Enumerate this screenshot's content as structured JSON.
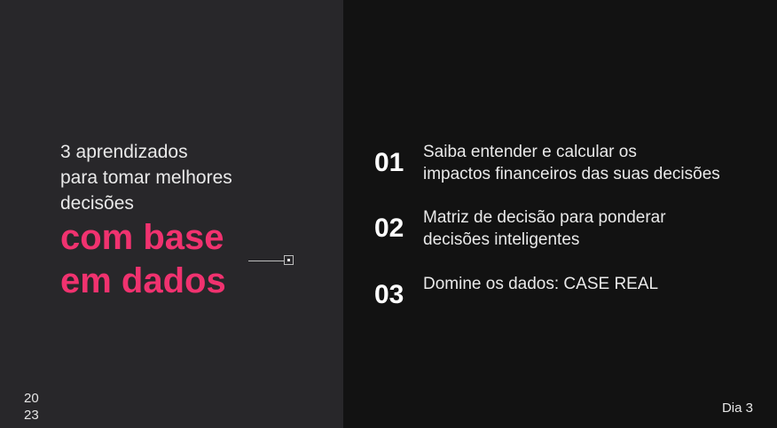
{
  "intro": {
    "lines": [
      "3 aprendizados",
      "para tomar melhores",
      "decisões"
    ]
  },
  "highlight": {
    "lines": [
      "com base",
      "em dados"
    ]
  },
  "items": [
    {
      "number": "01",
      "lines": [
        "Saiba entender e calcular os",
        "impactos financeiros das suas decisões"
      ]
    },
    {
      "number": "02",
      "lines": [
        "Matriz de decisão para ponderar",
        "decisões inteligentes"
      ]
    },
    {
      "number": "03",
      "lines": [
        "Domine os dados: CASE REAL"
      ]
    }
  ],
  "footer": {
    "year_lines": [
      "20",
      "23"
    ],
    "day_label": "Dia 3"
  },
  "colors": {
    "accent": "#f0326f",
    "left_bg": "#28272a",
    "right_bg": "#121212"
  }
}
